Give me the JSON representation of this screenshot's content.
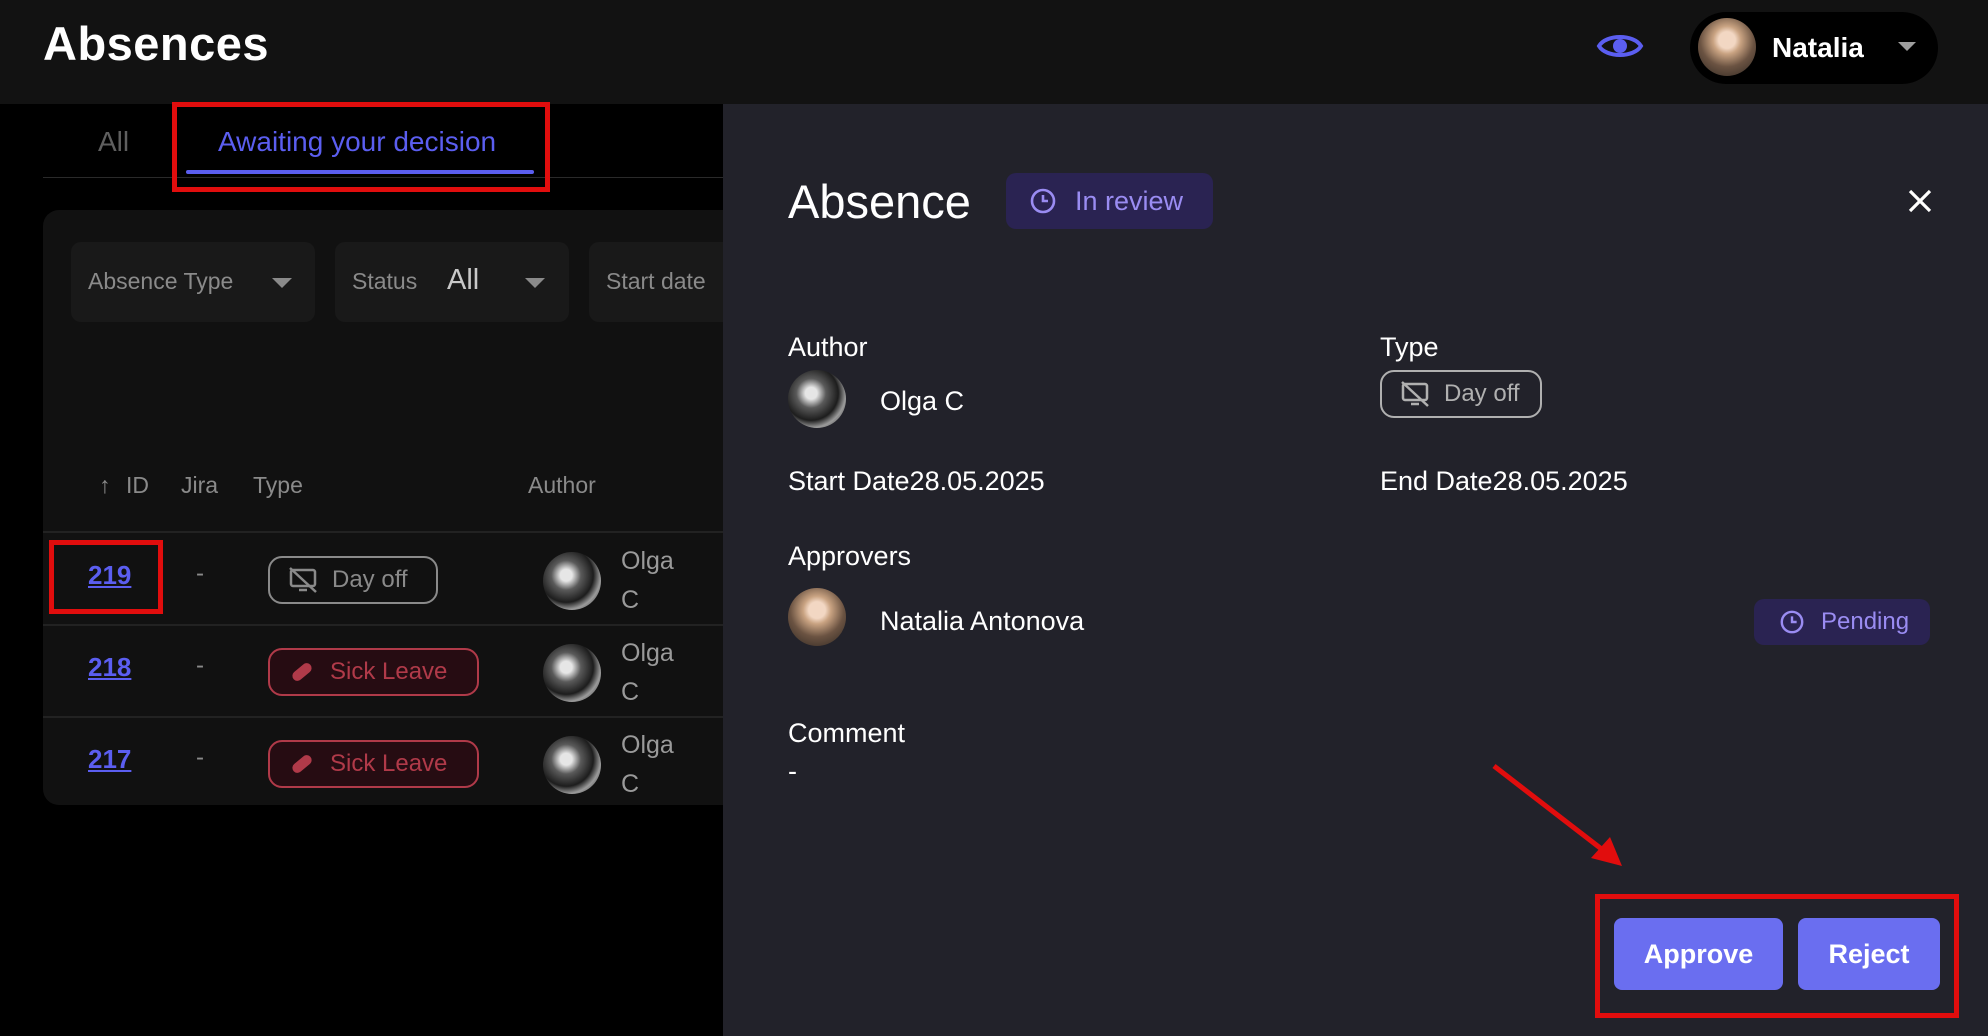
{
  "header": {
    "title": "Absences",
    "user_name": "Natalia"
  },
  "tabs": [
    {
      "label": "All"
    },
    {
      "label": "Awaiting your decision"
    }
  ],
  "filters": {
    "absence_type_label": "Absence Type",
    "status_label": "Status",
    "status_value": "All",
    "start_date_label": "Start date"
  },
  "table": {
    "columns": [
      "ID",
      "Jira",
      "Type",
      "Author"
    ],
    "rows": [
      {
        "id": "219",
        "jira": "-",
        "type": "Day off",
        "author": "Olga C"
      },
      {
        "id": "218",
        "jira": "-",
        "type": "Sick Leave",
        "author": "Olga C"
      },
      {
        "id": "217",
        "jira": "-",
        "type": "Sick Leave",
        "author": "Olga C"
      }
    ]
  },
  "detail": {
    "title": "Absence",
    "status": "In review",
    "author_label": "Author",
    "author_name": "Olga C",
    "type_label": "Type",
    "type_value": "Day off",
    "start_date_text": "Start Date28.05.2025",
    "end_date_text": "End Date28.05.2025",
    "approvers_label": "Approvers",
    "approver_name": "Natalia Antonova",
    "approver_status": "Pending",
    "comment_label": "Comment",
    "comment_value": "-",
    "approve_label": "Approve",
    "reject_label": "Reject"
  },
  "colors": {
    "accent": "#5b5ef0",
    "button": "#6a6ef0",
    "highlight": "#e10d0d",
    "sick_leave": "#b03a49",
    "badge_text": "#9a8cf2"
  }
}
